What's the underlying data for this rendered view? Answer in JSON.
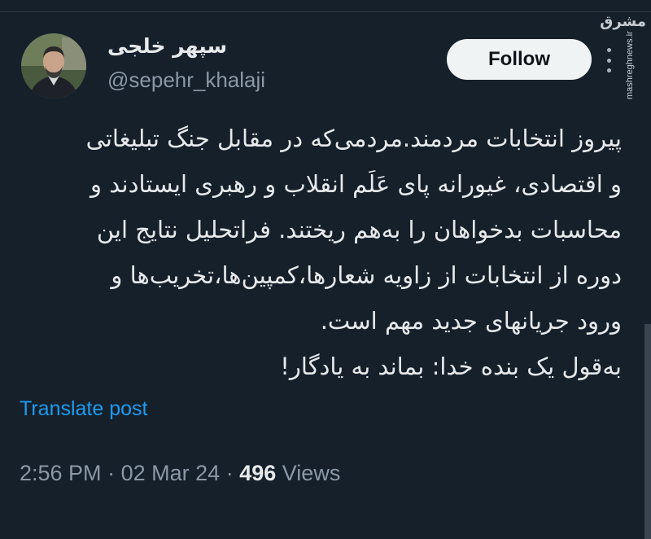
{
  "author": {
    "display_name": "سپهر خلجی",
    "handle": "@sepehr_khalaji"
  },
  "follow_label": "Follow",
  "tweet": {
    "lines": [
      "پیروز انتخابات مردمند.مردمی‌که در مقابل جنگ تبلیغاتی",
      "و اقتصادی، غیورانه پای عَلَم انقلاب و رهبری ایستادند و",
      "محاسبات بدخواهان را به‌هم ریختند. فراتحلیل نتایج این",
      "دوره از انتخابات از زاویه شعارها،کمپین‌ها،تخریب‌ها و",
      "ورود جریانهای جدید مهم است.",
      "به‌قول یک بنده خدا: بماند به یادگار!"
    ]
  },
  "translate_label": "Translate post",
  "meta": {
    "time": "2:56 PM",
    "separator": "·",
    "date": "02 Mar 24",
    "views_count": "496",
    "views_label": "Views"
  },
  "watermark": {
    "logo_text": "مشرق",
    "site": "mashreghnews.ir"
  },
  "colors": {
    "background": "#15202b",
    "text_primary": "#e7e9ea",
    "text_secondary": "#8b98a5",
    "link": "#1d9bf0",
    "button_bg": "#eff3f4"
  },
  "icons": {
    "more": "more-vertical-icon"
  }
}
